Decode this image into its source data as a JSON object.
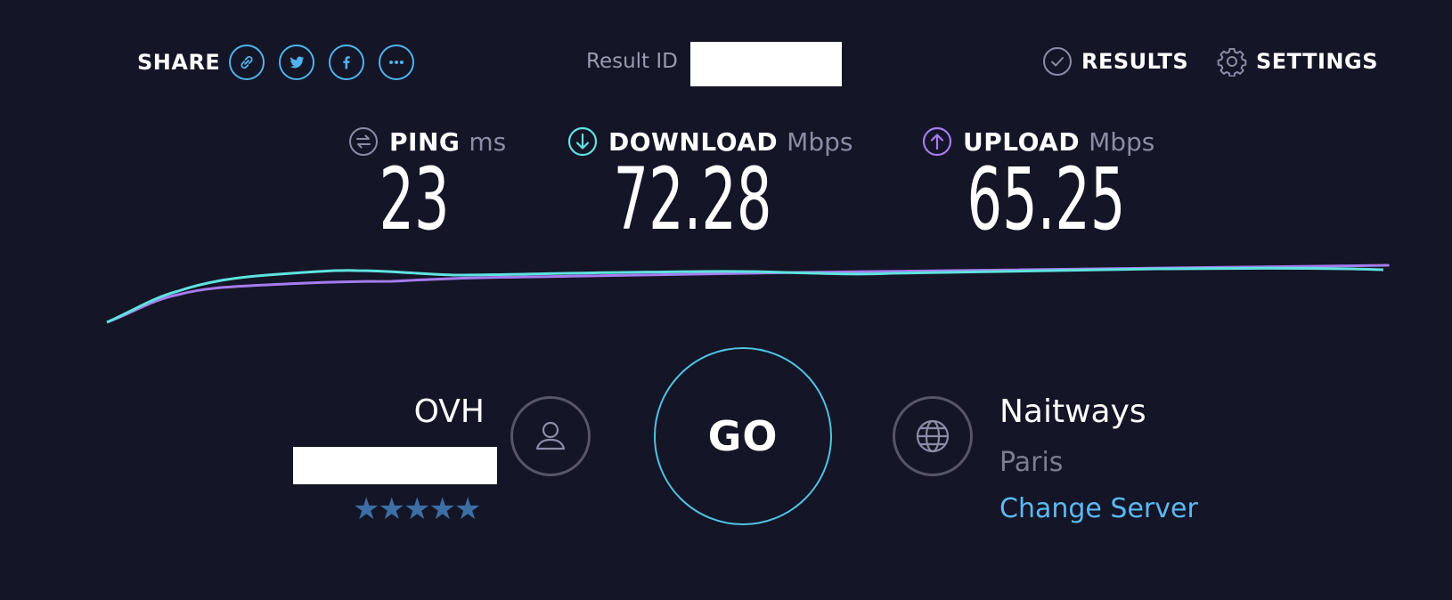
{
  "header": {
    "share_label": "SHARE",
    "share_icons": [
      "link-icon",
      "twitter-icon",
      "facebook-icon",
      "more-icon"
    ],
    "result_id_label": "Result ID",
    "results_label": "RESULTS",
    "settings_label": "SETTINGS"
  },
  "metrics": {
    "ping": {
      "label": "PING",
      "unit": "ms",
      "value": "23",
      "icon": "ping-icon"
    },
    "download": {
      "label": "DOWNLOAD",
      "unit": "Mbps",
      "value": "72.28",
      "icon": "download-arrow-icon"
    },
    "upload": {
      "label": "UPLOAD",
      "unit": "Mbps",
      "value": "65.25",
      "icon": "upload-arrow-icon"
    }
  },
  "colors": {
    "background": "#141526",
    "accent_blue": "#4fb3ee",
    "download": "#5fe3e0",
    "upload": "#a67cf0",
    "link": "#5bb9f3"
  },
  "provider": {
    "name": "OVH",
    "rating_stars": "★★★★★"
  },
  "go_label": "GO",
  "server": {
    "name": "Naitways",
    "location": "Paris",
    "change_label": "Change Server"
  }
}
